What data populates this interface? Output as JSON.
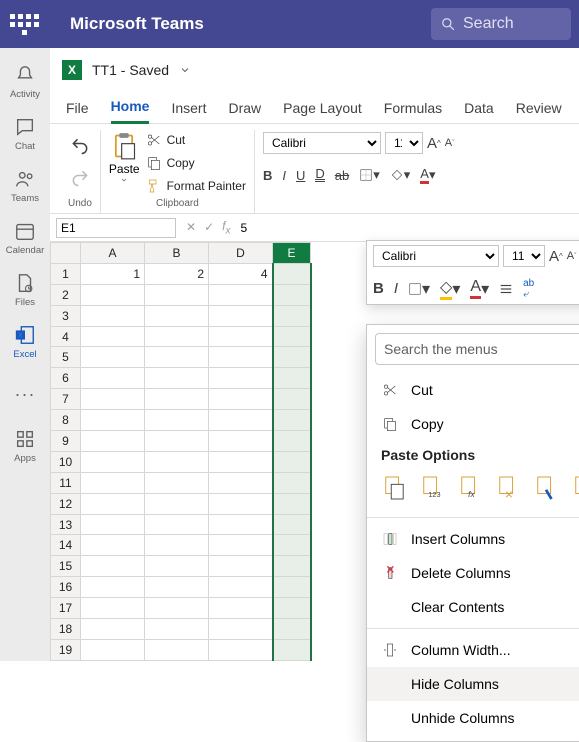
{
  "titlebar": {
    "app": "Microsoft Teams",
    "search_placeholder": "Search"
  },
  "rail": {
    "items": [
      {
        "label": "Activity"
      },
      {
        "label": "Chat"
      },
      {
        "label": "Teams"
      },
      {
        "label": "Calendar"
      },
      {
        "label": "Files"
      },
      {
        "label": "Excel"
      },
      {
        "label": "Apps"
      }
    ]
  },
  "file": {
    "logo": "X",
    "name": "TT1  - Saved"
  },
  "tabs": [
    "File",
    "Home",
    "Insert",
    "Draw",
    "Page Layout",
    "Formulas",
    "Data",
    "Review"
  ],
  "ribbon": {
    "undo_label": "Undo",
    "clipboard_label": "Clipboard",
    "paste": "Paste",
    "cut": "Cut",
    "copy": "Copy",
    "format_painter": "Format Painter",
    "font_name": "Calibri",
    "font_size": "11"
  },
  "mini": {
    "font_name": "Calibri",
    "font_size": "11"
  },
  "formula": {
    "cell": "E1",
    "value": "5"
  },
  "sheet": {
    "cols": [
      "A",
      "B",
      "D",
      "E"
    ],
    "row1": {
      "A": "1",
      "B": "2",
      "D": "4"
    },
    "rows": 19
  },
  "ctx": {
    "search_placeholder": "Search the menus",
    "cut": "Cut",
    "copy": "Copy",
    "paste_header": "Paste Options",
    "insert": "Insert Columns",
    "delete": "Delete Columns",
    "clear": "Clear Contents",
    "width": "Column Width...",
    "hide": "Hide Columns",
    "unhide": "Unhide Columns"
  }
}
